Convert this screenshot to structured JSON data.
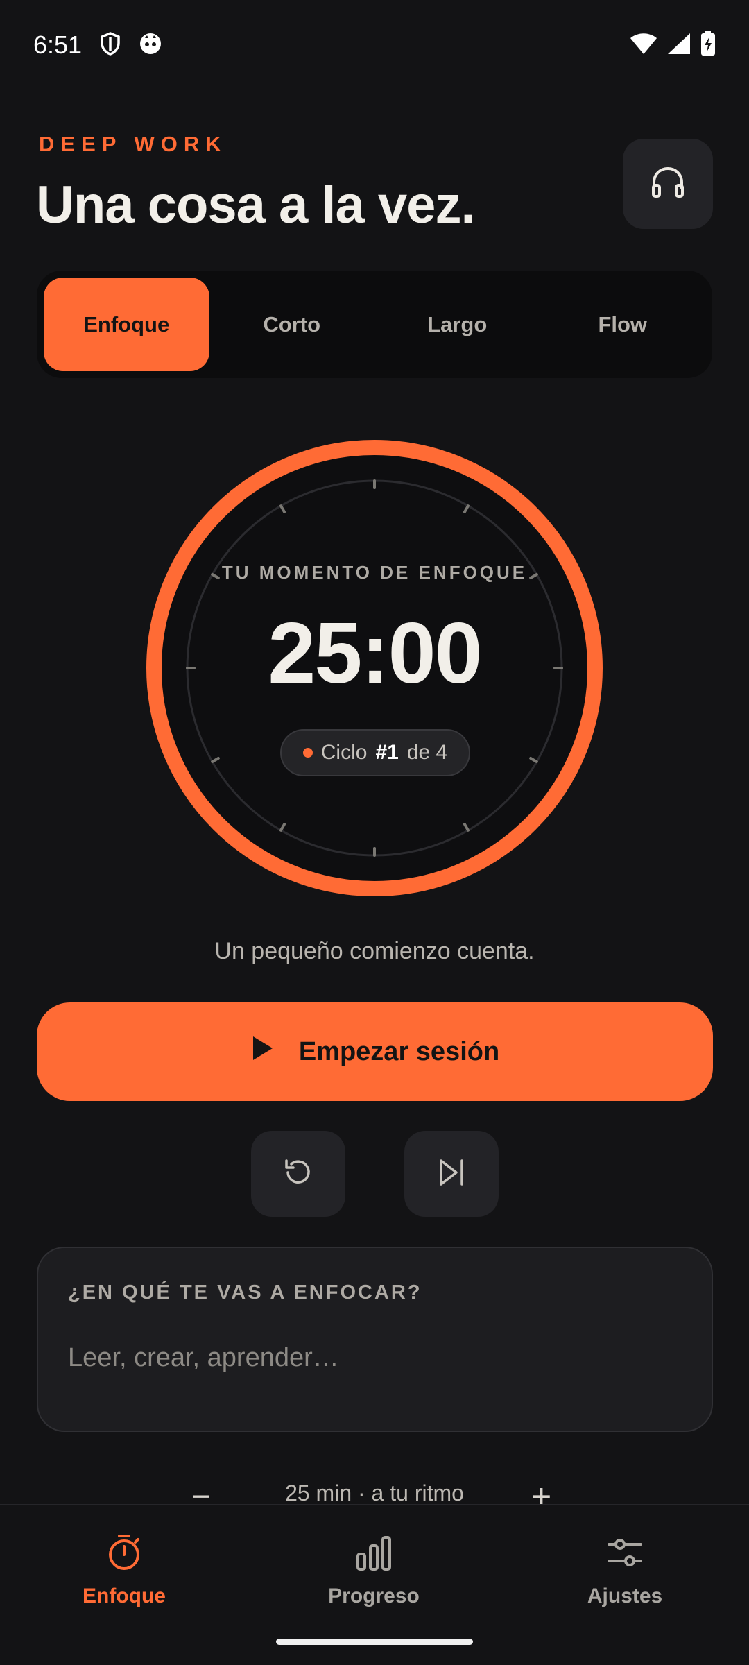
{
  "status_bar": {
    "time": "6:51",
    "icons": [
      "shield-icon",
      "cat-icon",
      "wifi-icon",
      "signal-icon",
      "battery-charging-icon"
    ]
  },
  "header": {
    "eyebrow": "DEEP WORK",
    "title": "Una cosa a la vez.",
    "audio_button_icon": "headphones-icon"
  },
  "modes": {
    "tabs": [
      {
        "label": "Enfoque",
        "active": true
      },
      {
        "label": "Corto",
        "active": false
      },
      {
        "label": "Largo",
        "active": false
      },
      {
        "label": "Flow",
        "active": false
      }
    ]
  },
  "timer": {
    "label": "TU MOMENTO DE ENFOQUE",
    "time": "25:00",
    "progress": 1.0,
    "cycle": {
      "prefix": "Ciclo",
      "number": "#1",
      "suffix": "de 4"
    }
  },
  "message": "Un pequeño comienzo cuenta.",
  "actions": {
    "start_label": "Empezar sesión",
    "start_icon": "play-icon",
    "reset_icon": "reset-icon",
    "skip_icon": "skip-next-icon"
  },
  "focus": {
    "question": "¿EN QUÉ TE VAS A ENFOCAR?",
    "placeholder": "Leer, crear, aprender…",
    "value": ""
  },
  "duration": {
    "minus": "−",
    "text": "25 min · a tu ritmo",
    "plus": "+"
  },
  "nav": {
    "items": [
      {
        "label": "Enfoque",
        "icon": "stopwatch-icon",
        "active": true
      },
      {
        "label": "Progreso",
        "icon": "bar-chart-icon",
        "active": false
      },
      {
        "label": "Ajustes",
        "icon": "sliders-icon",
        "active": false
      }
    ]
  },
  "colors": {
    "accent": "#ff6b35",
    "background": "#131315",
    "surface": "#232327"
  }
}
